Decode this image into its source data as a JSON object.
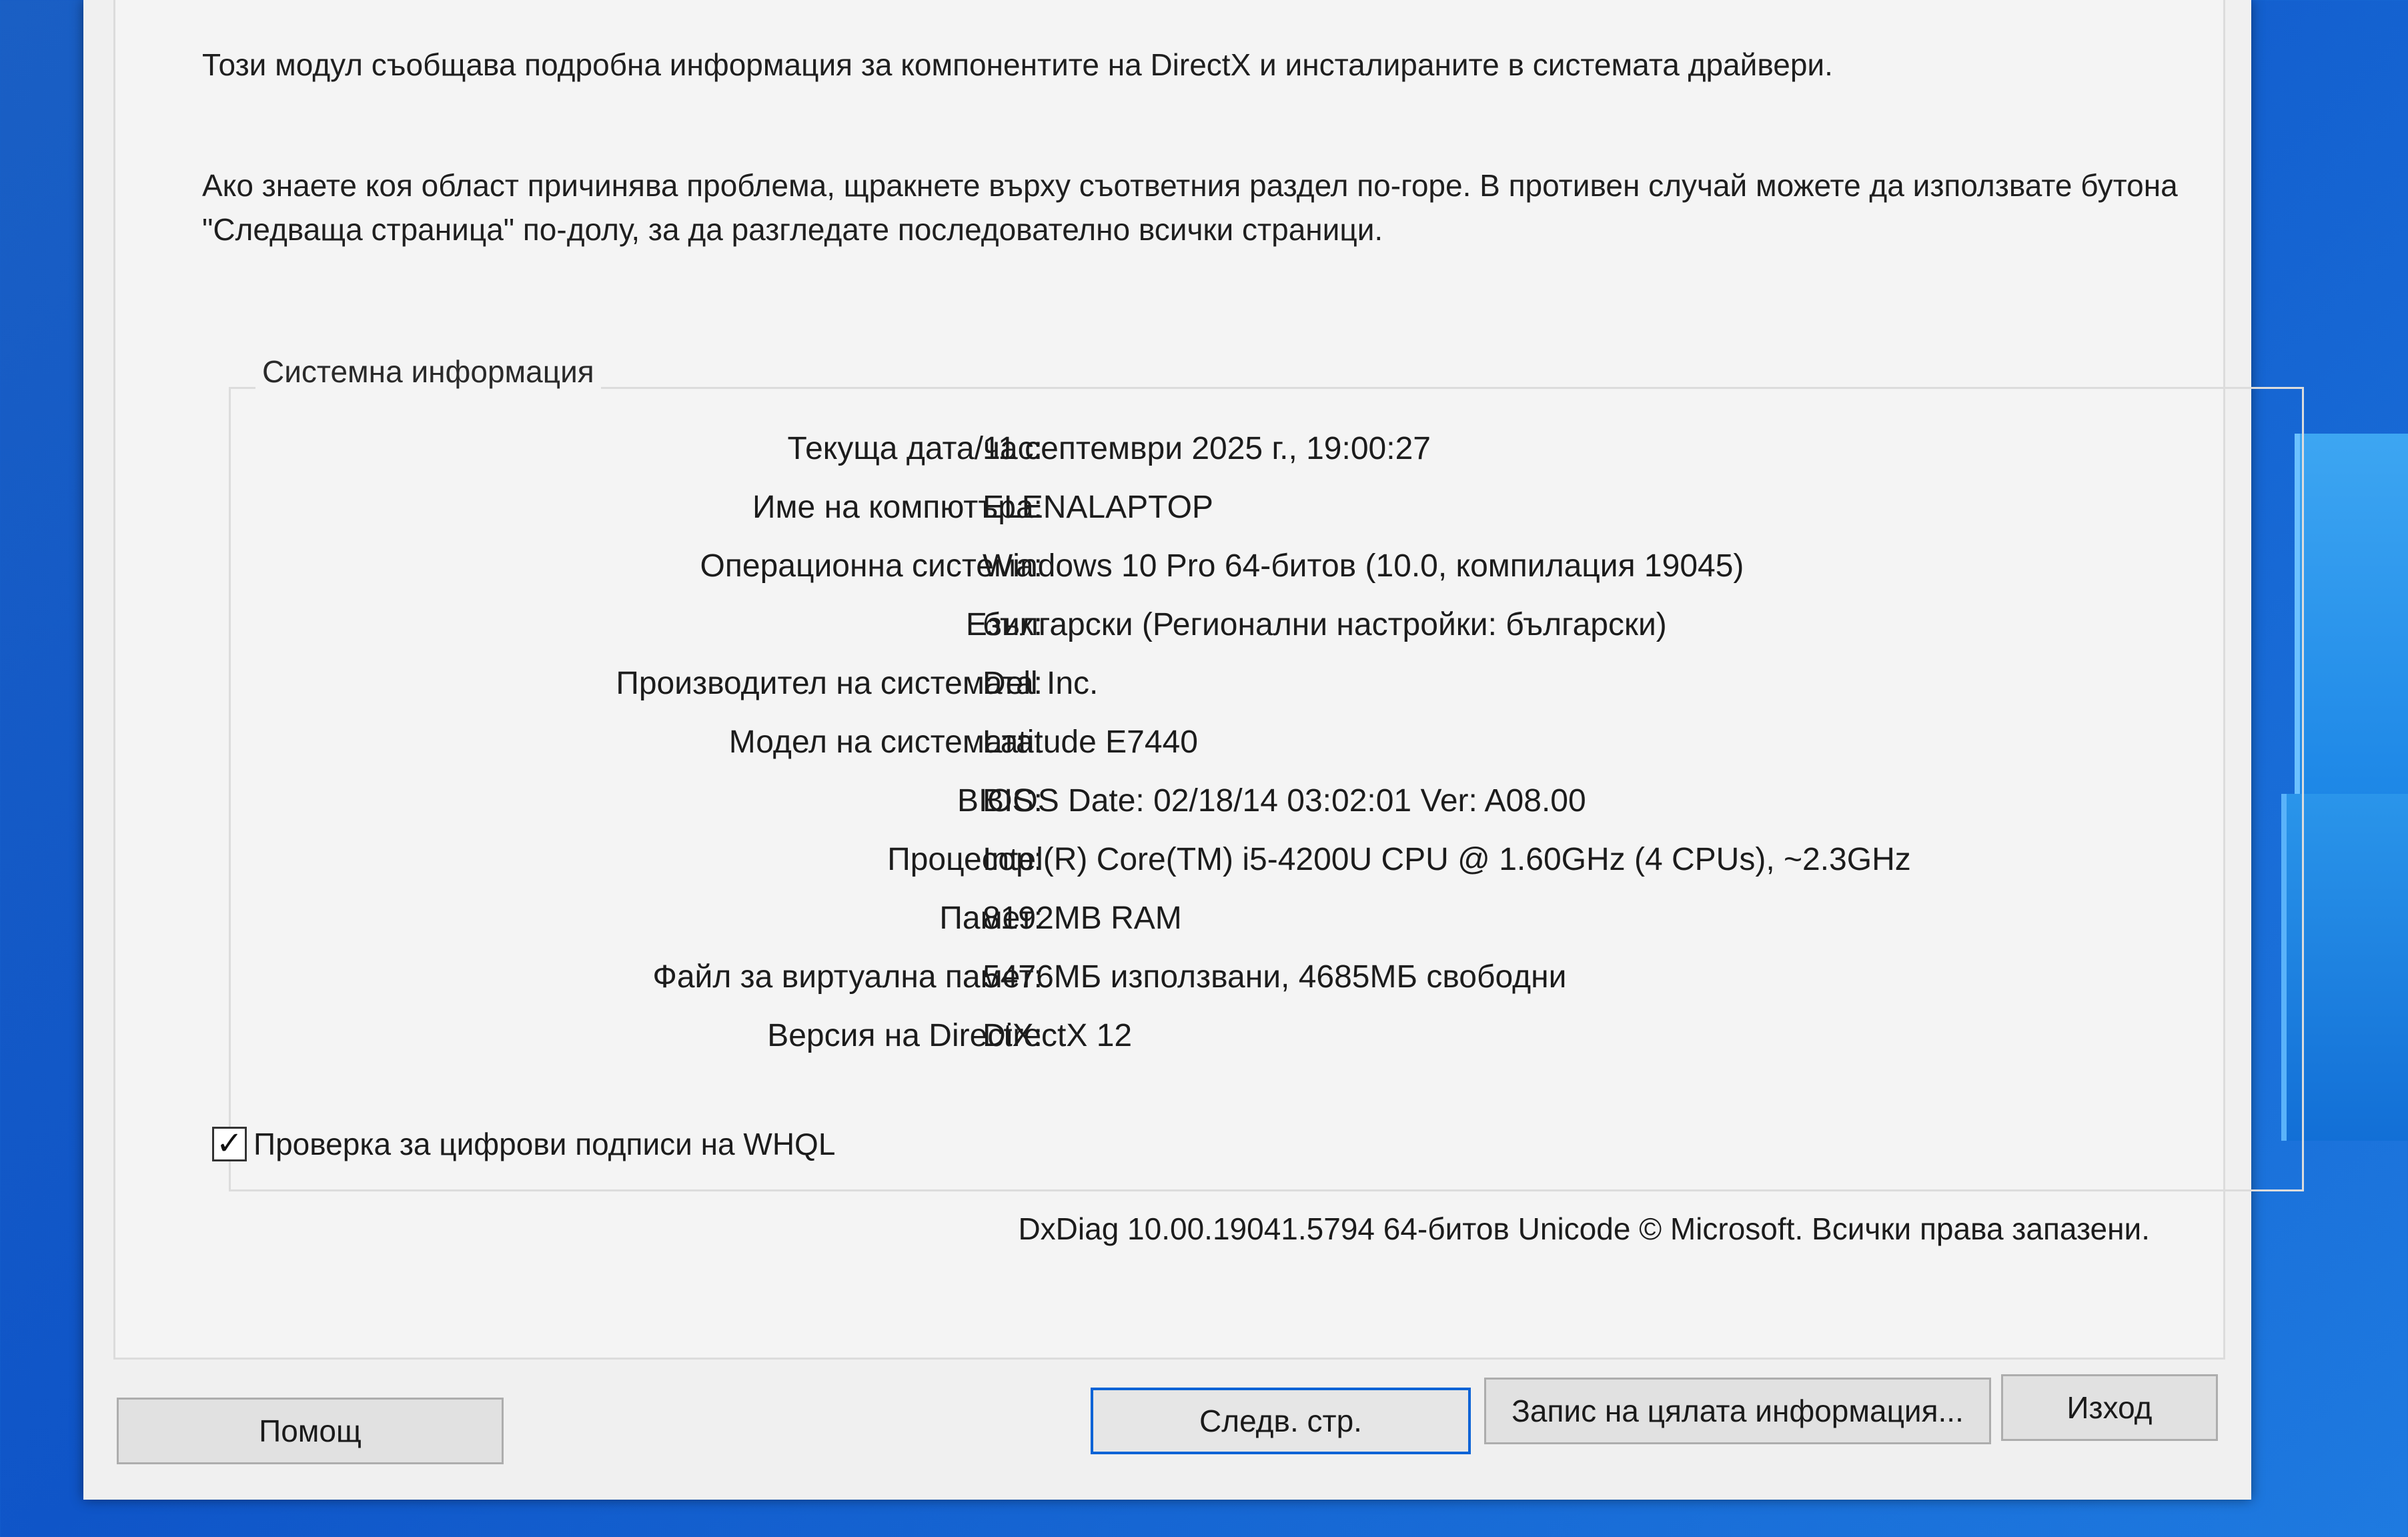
{
  "intro": {
    "line1": "Този модул съобщава подробна информация за компонентите на DirectX и инсталираните в системата драйвери.",
    "line2": "Ако знаете коя област причинява проблема, щракнете върху съответния раздел по-горе. В противен случай можете да използвате бутона \"Следваща страница\" по-долу, за да разгледате последователно всички страници."
  },
  "system_info": {
    "title": "Системна информация",
    "rows": [
      {
        "label": "Текуща дата/час:",
        "value": "11 септември 2025 г., 19:00:27"
      },
      {
        "label": "Име на компютъра:",
        "value": "ELENALAPTOP"
      },
      {
        "label": "Операционна система:",
        "value": "Windows 10 Pro 64-битов (10.0, компилация 19045)"
      },
      {
        "label": "Език:",
        "value": "български (Регионални настройки: български)"
      },
      {
        "label": "Производител на системата:",
        "value": "Dell Inc."
      },
      {
        "label": "Модел на системата:",
        "value": "Latitude E7440"
      },
      {
        "label": "BIOS:",
        "value": "BIOS Date: 02/18/14 03:02:01 Ver: A08.00"
      },
      {
        "label": "Процесор:",
        "value": "Intel(R) Core(TM) i5-4200U CPU @ 1.60GHz (4 CPUs), ~2.3GHz"
      },
      {
        "label": "Памет:",
        "value": "8192MB RAM"
      },
      {
        "label": "Файл за виртуална памет:",
        "value": "5476МБ използвани, 4685МБ свободни"
      },
      {
        "label": "Версия на DirectX:",
        "value": "DirectX 12"
      }
    ],
    "whql_checkbox": {
      "label": "Проверка за цифрови подписи на WHQL",
      "checked": true,
      "mark": "✓"
    }
  },
  "copyright": "DxDiag 10.00.19041.5794 64-битов Unicode © Microsoft. Всички права запазени.",
  "buttons": {
    "help": "Помощ",
    "next_page": "Следв. стр.",
    "save_all": "Запис на цялата информация...",
    "exit": "Изход"
  },
  "colors": {
    "desktop_bg": "#0f55c8",
    "window_bg": "#f0f0f0",
    "default_button_border": "#0a63d6"
  },
  "icons": {
    "checkbox": "checkmark-icon"
  }
}
